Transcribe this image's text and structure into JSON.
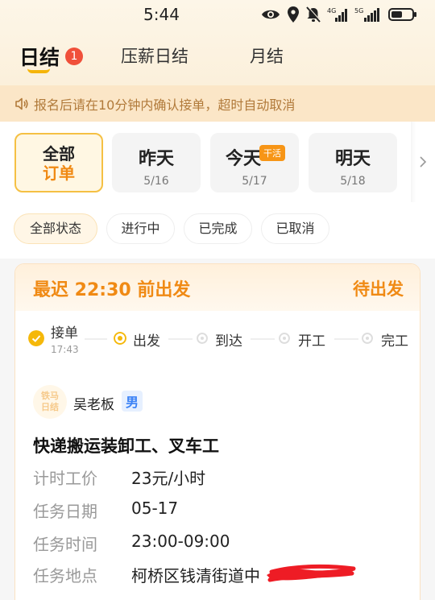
{
  "status_bar": {
    "time": "5:44",
    "icons": [
      "eye-icon",
      "location-icon",
      "mute-icon",
      "signal-4g-icon",
      "signal-5g-icon",
      "battery-icon"
    ],
    "net1": "4G",
    "net2": "5G"
  },
  "tabs": [
    {
      "label": "日结",
      "active": true,
      "badge": "1"
    },
    {
      "label": "压薪日结",
      "active": false
    },
    {
      "label": "月结",
      "active": false
    }
  ],
  "notice": {
    "icon": "speaker-icon",
    "text": "报名后请在10分钟内确认接单，超时自动取消"
  },
  "date_filter": {
    "all_line1": "全部",
    "all_line2": "订单",
    "days": [
      {
        "label": "昨天",
        "date": "5/16"
      },
      {
        "label": "今天",
        "date": "5/17",
        "badge": "干活"
      },
      {
        "label": "明天",
        "date": "5/18"
      }
    ],
    "more_icon": "chevron-right-icon"
  },
  "status_filters": [
    {
      "label": "全部状态",
      "active": true
    },
    {
      "label": "进行中",
      "active": false
    },
    {
      "label": "已完成",
      "active": false
    },
    {
      "label": "已取消",
      "active": false
    }
  ],
  "order": {
    "deadline": "最迟 22:30 前出发",
    "status": "待出发",
    "steps": [
      {
        "label": "接单",
        "time": "17:43",
        "state": "done"
      },
      {
        "label": "出发",
        "state": "current"
      },
      {
        "label": "到达",
        "state": "pending"
      },
      {
        "label": "开工",
        "state": "pending"
      },
      {
        "label": "完工",
        "state": "pending"
      }
    ],
    "avatar_text1": "铁马",
    "avatar_text2": "日结",
    "boss_name": "吴老板",
    "gender": "男",
    "job_title": "快递搬运装卸工、叉车工",
    "info": [
      {
        "key": "计时工价",
        "value": "23元/小时"
      },
      {
        "key": "任务日期",
        "value": "05-17"
      },
      {
        "key": "任务时间",
        "value": "23:00-09:00"
      },
      {
        "key": "任务地点",
        "value": "柯桥区钱清街道中"
      }
    ]
  },
  "colors": {
    "accent": "#f08a14",
    "badge_red": "#f0503a",
    "notice_bg": "#fbe6c7",
    "notice_text": "#b17a3a",
    "redaction": "#ee1c25"
  }
}
